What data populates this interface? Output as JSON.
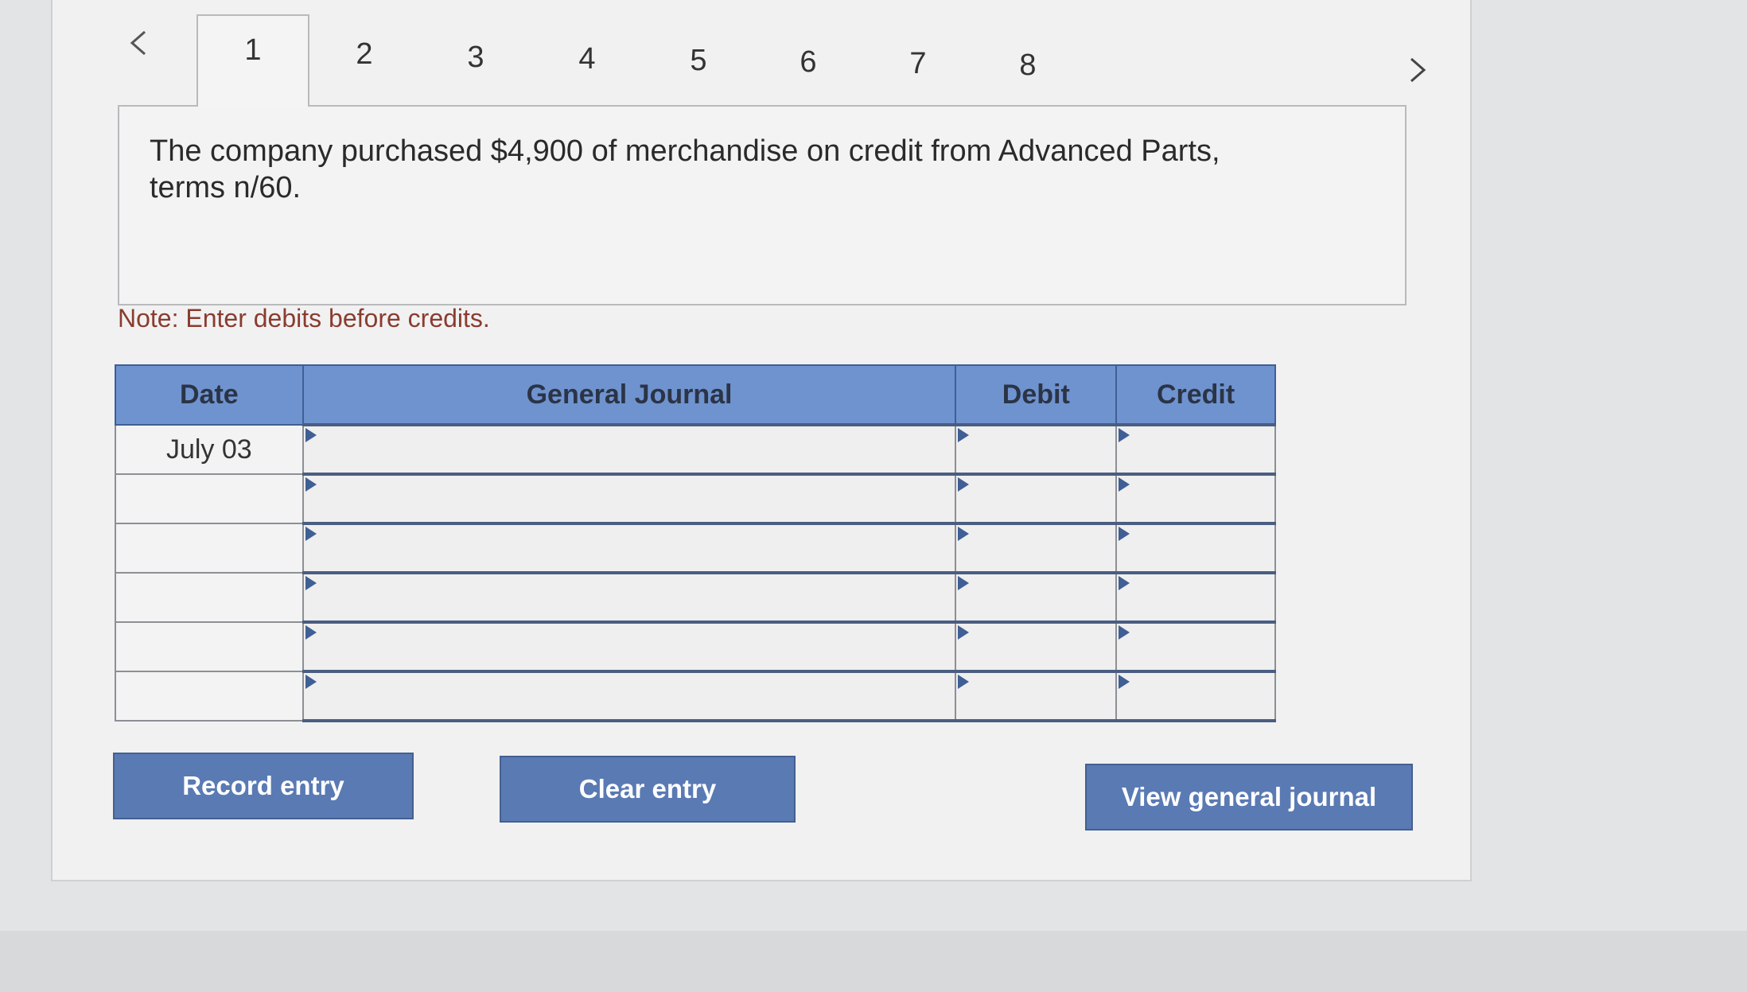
{
  "tabs": {
    "prev_icon": "chevron-left-icon",
    "next_icon": "chevron-right-icon",
    "items": [
      {
        "label": "1",
        "active": true
      },
      {
        "label": "2"
      },
      {
        "label": "3"
      },
      {
        "label": "4"
      },
      {
        "label": "5"
      },
      {
        "label": "6"
      },
      {
        "label": "7"
      },
      {
        "label": "8"
      }
    ]
  },
  "question": {
    "text": "The company purchased $4,900 of merchandise on credit from Advanced Parts, terms n/60."
  },
  "note": "Note: Enter debits before credits.",
  "journal": {
    "headers": {
      "date": "Date",
      "general_journal": "General Journal",
      "debit": "Debit",
      "credit": "Credit"
    },
    "rows": [
      {
        "date": "July 03",
        "account": "",
        "debit": "",
        "credit": ""
      },
      {
        "date": "",
        "account": "",
        "debit": "",
        "credit": ""
      },
      {
        "date": "",
        "account": "",
        "debit": "",
        "credit": ""
      },
      {
        "date": "",
        "account": "",
        "debit": "",
        "credit": ""
      },
      {
        "date": "",
        "account": "",
        "debit": "",
        "credit": ""
      },
      {
        "date": "",
        "account": "",
        "debit": "",
        "credit": ""
      }
    ]
  },
  "buttons": {
    "record": "Record entry",
    "clear": "Clear entry",
    "view": "View general journal"
  },
  "colors": {
    "header_bg": "#6f93cf",
    "button_bg": "#5a7ab4",
    "note_text": "#8a3c2f"
  }
}
